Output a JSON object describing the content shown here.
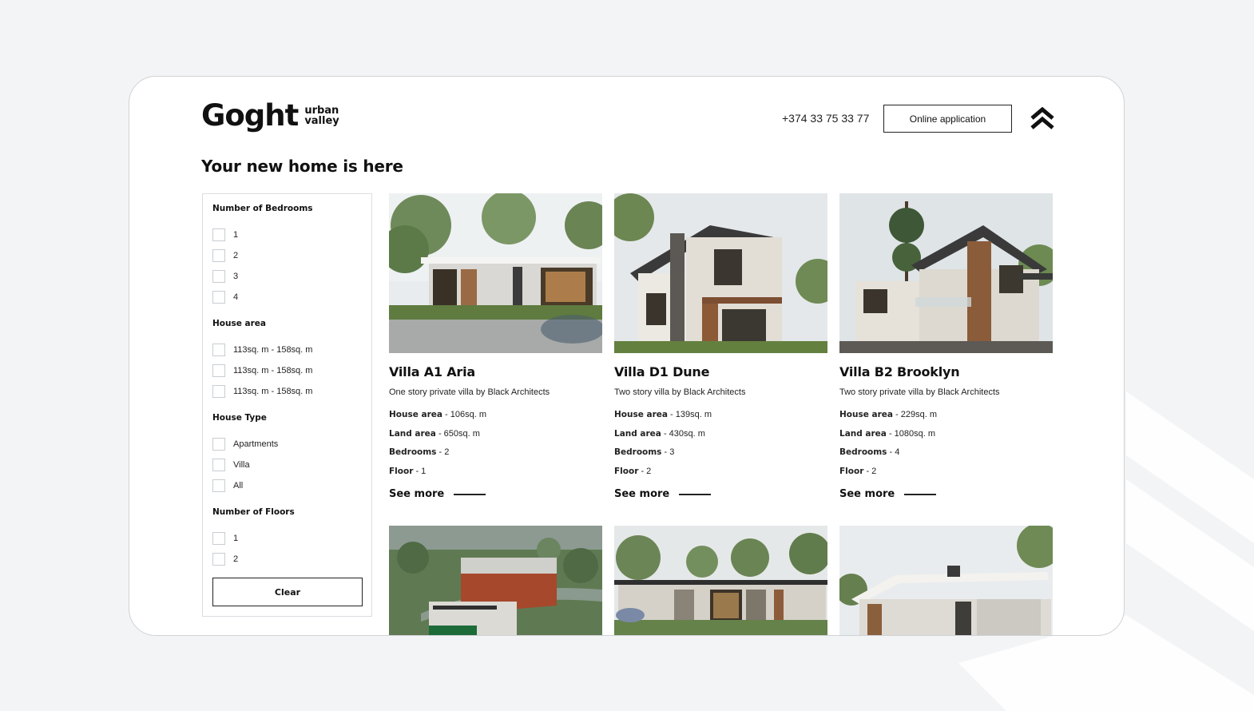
{
  "brand": {
    "name": "Goght",
    "sub_line1": "urban",
    "sub_line2": "valley"
  },
  "header": {
    "phone": "+374 33 75 33 77",
    "apply_label": "Online application",
    "scroll_icon": "double-chevron-up-icon"
  },
  "page": {
    "title": "Your new home is here"
  },
  "filters": {
    "bedrooms": {
      "title": "Number of Bedrooms",
      "options": [
        "1",
        "2",
        "3",
        "4"
      ]
    },
    "area": {
      "title": "House area",
      "options": [
        "113sq. m - 158sq. m",
        "113sq. m - 158sq. m",
        "113sq. m - 158sq. m"
      ]
    },
    "type": {
      "title": "House Type",
      "options": [
        "Apartments",
        "Villa",
        "All"
      ]
    },
    "floors": {
      "title": "Number of Floors",
      "options": [
        "1",
        "2"
      ]
    },
    "clear_label": "Clear"
  },
  "listings": [
    {
      "title": "Villa A1 Aria",
      "description": "One story private villa by Black Architects",
      "area_label": "House area",
      "area_value": " - 106sq. m",
      "land_label": "Land area",
      "land_value": "  - 650sq. m",
      "bedrooms_label": "Bedrooms",
      "bedrooms_value": " - 2",
      "floor_label": "Floor",
      "floor_value": " - 1",
      "see_more": "See more"
    },
    {
      "title": "Villa D1 Dune",
      "description": "Two story villa by Black Architects",
      "area_label": "House area",
      "area_value": " - 139sq. m",
      "land_label": "Land area",
      "land_value": "  - 430sq. m",
      "bedrooms_label": "Bedrooms",
      "bedrooms_value": " - 3",
      "floor_label": "Floor",
      "floor_value": " - 2",
      "see_more": "See more"
    },
    {
      "title": "Villa B2 Brooklyn",
      "description": "Two story private villa by Black Architects",
      "area_label": "House area",
      "area_value": " - 229sq. m",
      "land_label": "Land area",
      "land_value": " - 1080sq. m",
      "bedrooms_label": "Bedrooms",
      "bedrooms_value": " - 4",
      "floor_label": "Floor",
      "floor_value": " - 2",
      "see_more": "See more"
    }
  ],
  "colors": {
    "background": "#f3f4f6",
    "frame": "#ffffff",
    "text": "#111111",
    "border": "#dadde1"
  }
}
